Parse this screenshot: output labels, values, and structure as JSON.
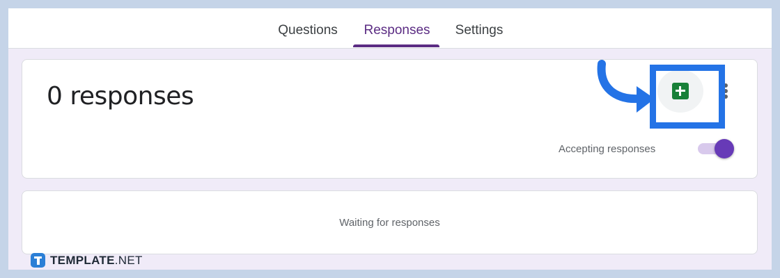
{
  "tabs": {
    "questions": "Questions",
    "responses": "Responses",
    "settings": "Settings",
    "active": "Responses"
  },
  "summary": {
    "response_count_text": "0 responses",
    "accepting_label": "Accepting responses",
    "accepting_on": true,
    "sheets_icon": "google-sheets-icon",
    "more_icon": "more-vert-icon"
  },
  "waiting": {
    "text": "Waiting for responses"
  },
  "watermark": {
    "brand": "TEMPLATE",
    "suffix": ".NET"
  },
  "colors": {
    "accent": "#673ab7",
    "tab_active": "#5b2c83",
    "highlight": "#2473e6",
    "sheets_green": "#188038",
    "page_background": "#f0ebf8"
  }
}
